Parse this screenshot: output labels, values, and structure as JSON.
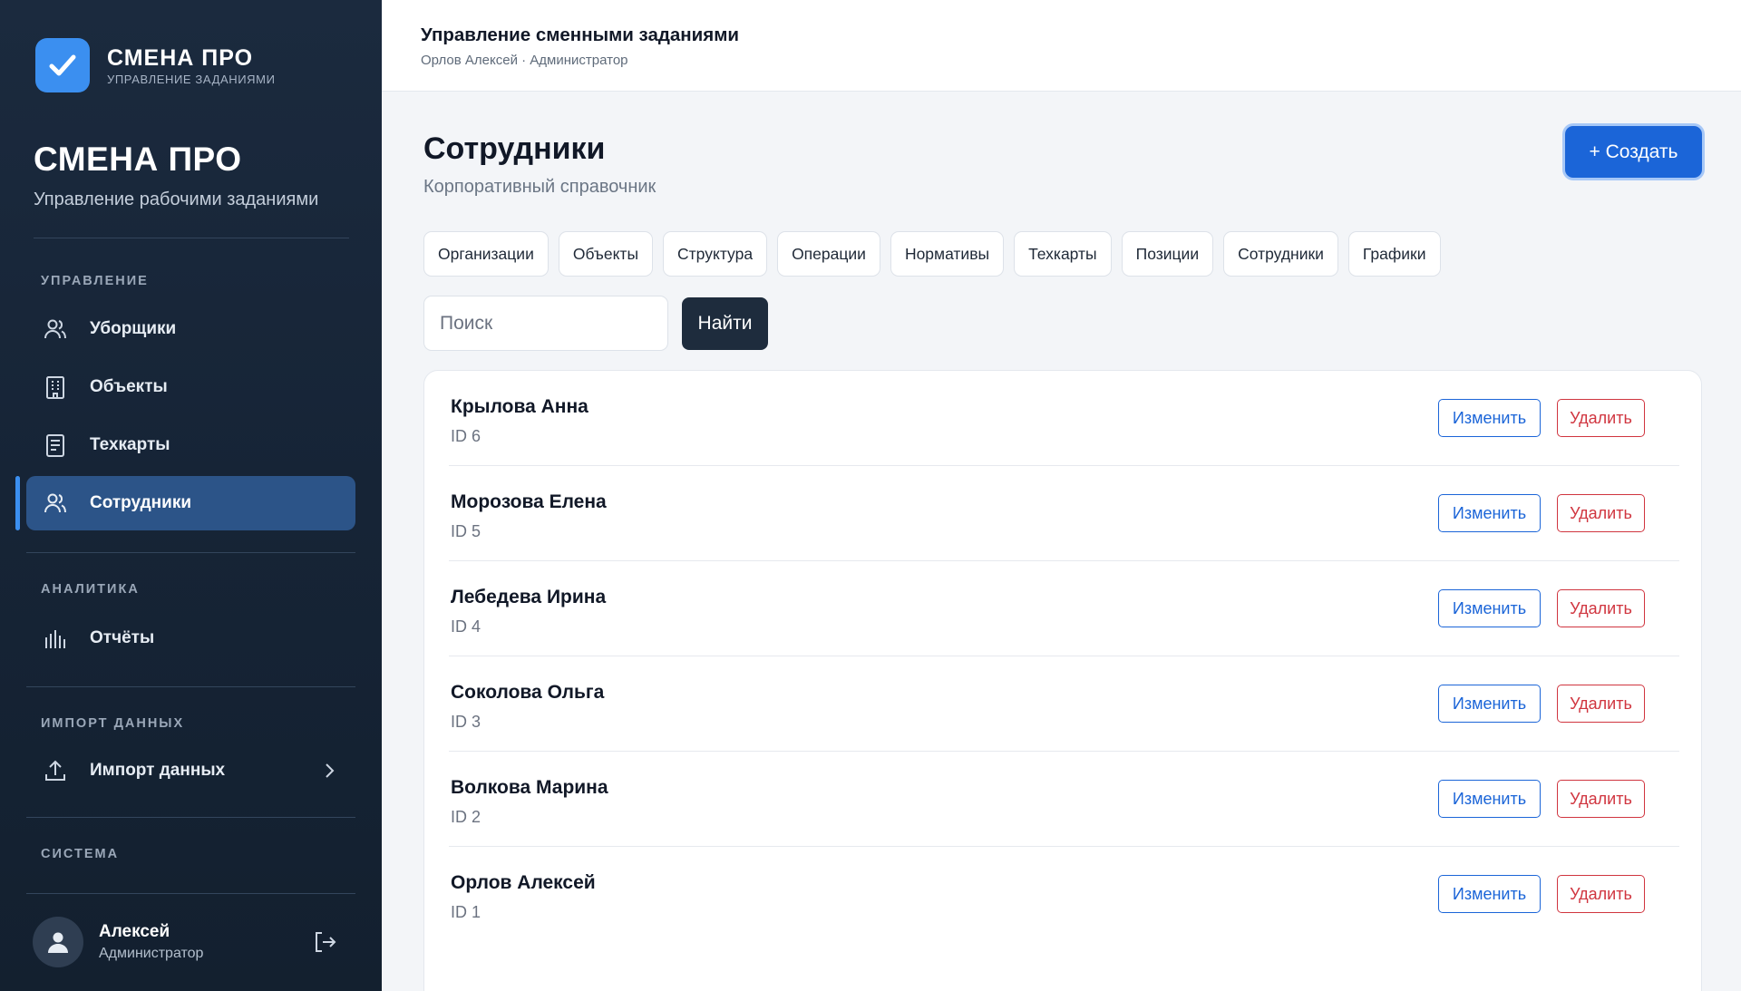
{
  "brand": {
    "name": "СМЕНА ПРО",
    "subtitle": "УПРАВЛЕНИЕ ЗАДАНИЯМИ",
    "logo_icon": "check-icon",
    "accent": "#3b8ff0"
  },
  "sidebar": {
    "title": "СМЕНА ПРО",
    "subtitle": "Управление рабочими заданиями",
    "sections": {
      "management": "УПРАВЛЕНИЕ",
      "analytics": "АНАЛИТИКА",
      "import": "ИМПОРТ ДАННЫХ",
      "system": "СИСТЕМА"
    },
    "items": [
      {
        "label": "Уборщики",
        "icon": "users-icon"
      },
      {
        "label": "Объекты",
        "icon": "building-icon"
      },
      {
        "label": "Техкарты",
        "icon": "document-icon"
      },
      {
        "label": "Сотрудники",
        "icon": "users-icon",
        "active": true
      },
      {
        "label": "Отчёты",
        "icon": "bar-chart-icon"
      },
      {
        "label": "Импорт данных",
        "icon": "upload-icon"
      }
    ],
    "user": {
      "name": "Алексей",
      "role": "Администратор"
    }
  },
  "header": {
    "title": "Управление сменными заданиями",
    "subtitle": "Орлов Алексей · Администратор"
  },
  "page": {
    "title": "Сотрудники",
    "subtitle": "Корпоративный справочник",
    "create_label": "+ Создать",
    "tabs": [
      "Организации",
      "Объекты",
      "Структура",
      "Операции",
      "Нормативы",
      "Техкарты",
      "Позиции",
      "Сотрудники",
      "Графики"
    ],
    "search": {
      "placeholder": "Поиск",
      "button": "Найти"
    }
  },
  "employees": [
    {
      "name": "Крылова Анна",
      "id": "ID 6"
    },
    {
      "name": "Морозова Елена",
      "id": "ID 5"
    },
    {
      "name": "Лебедева Ирина",
      "id": "ID 4"
    },
    {
      "name": "Соколова Ольга",
      "id": "ID 3"
    },
    {
      "name": "Волкова Марина",
      "id": "ID 2"
    },
    {
      "name": "Орлов Алексей",
      "id": "ID 1"
    }
  ],
  "actions": {
    "edit": "Изменить",
    "delete": "Удалить"
  },
  "colors": {
    "primary": "#1b65d8",
    "danger": "#d0353f",
    "sidebar": "#1b2a3e"
  }
}
